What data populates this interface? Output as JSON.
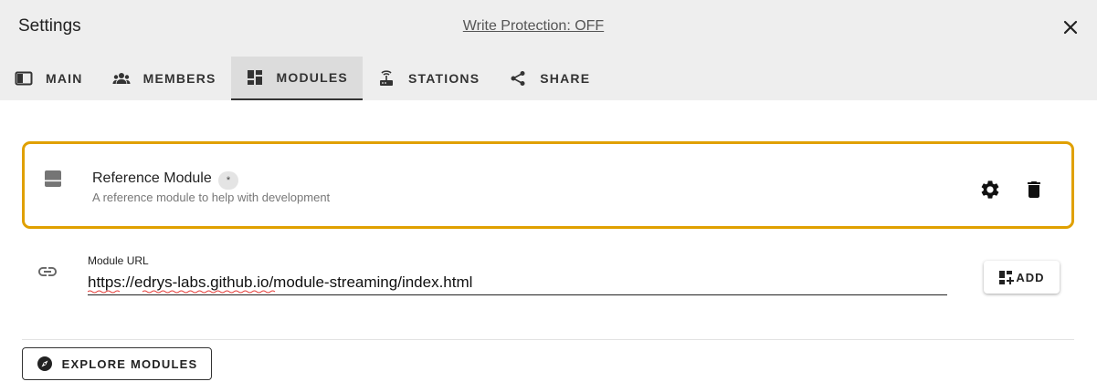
{
  "dialog": {
    "title": "Settings",
    "write_protection": "Write Protection: OFF",
    "close_icon": "close-icon"
  },
  "tabs": [
    {
      "label": "MAIN",
      "icon": "main-icon",
      "active": false
    },
    {
      "label": "MEMBERS",
      "icon": "members-icon",
      "active": false
    },
    {
      "label": "MODULES",
      "icon": "modules-icon",
      "active": true
    },
    {
      "label": "STATIONS",
      "icon": "stations-icon",
      "active": false
    },
    {
      "label": "SHARE",
      "icon": "share-icon",
      "active": false
    }
  ],
  "module": {
    "title": "Reference Module",
    "badge": "*",
    "description": "A reference module to help with development",
    "icon": "module-icon",
    "highlight_color": "#e0a000"
  },
  "url_field": {
    "label": "Module URL",
    "value": "https://edrys-labs.github.io/module-streaming/index.html"
  },
  "add_button": {
    "label": "ADD",
    "icon": "add-module-icon"
  },
  "explore_button": {
    "label": "EXPLORE MODULES",
    "icon": "compass-icon"
  }
}
